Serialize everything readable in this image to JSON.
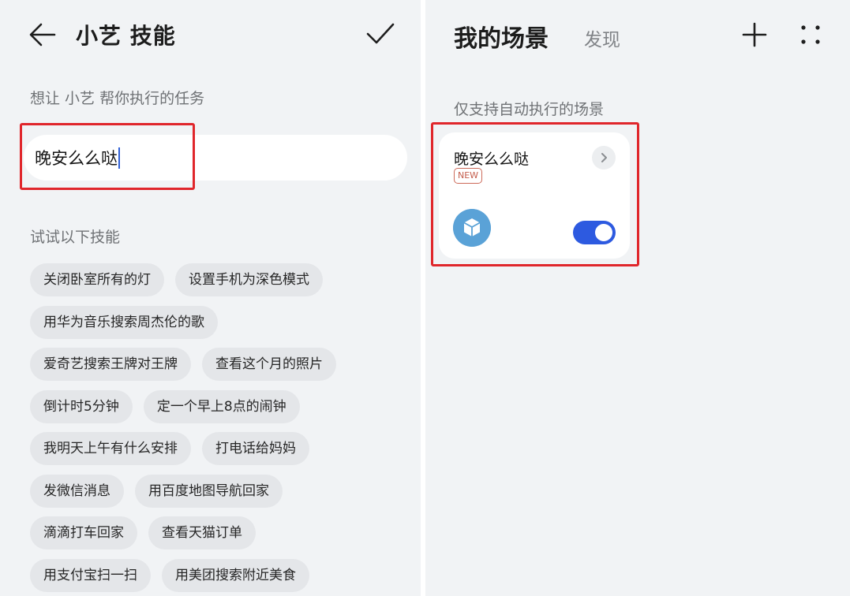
{
  "skills_panel": {
    "title": "小艺 技能",
    "task_prompt": "想让 小艺 帮你执行的任务",
    "task_value": "晚安么么哒",
    "suggestions_label": "试试以下技能",
    "suggestion_rows": [
      [
        "关闭卧室所有的灯",
        "设置手机为深色模式"
      ],
      [
        "用华为音乐搜索周杰伦的歌"
      ],
      [
        "爱奇艺搜索王牌对王牌",
        "查看这个月的照片"
      ],
      [
        "倒计时5分钟",
        "定一个早上8点的闹钟"
      ],
      [
        "我明天上午有什么安排",
        "打电话给妈妈"
      ],
      [
        "发微信消息",
        "用百度地图导航回家"
      ],
      [
        "滴滴打车回家",
        "查看天猫订单"
      ],
      [
        "用支付宝扫一扫",
        "用美团搜索附近美食"
      ]
    ],
    "icons": {
      "back": "arrow-left-icon",
      "confirm": "check-icon"
    }
  },
  "scenes_panel": {
    "title": "我的场景",
    "discover_tab": "发现",
    "auto_label": "仅支持自动执行的场景",
    "scene": {
      "name": "晚安么么哒",
      "badge": "NEW",
      "enabled": true,
      "icon": "cube-icon"
    },
    "icons": {
      "add": "plus-icon",
      "more": "more-dots-icon",
      "open": "chevron-right-icon"
    }
  },
  "colors": {
    "background": "#f1f3f5",
    "card": "#ffffff",
    "chip": "#e4e6e9",
    "highlight": "#e0262b",
    "toggle_on": "#2d5ae0",
    "badge": "#c45d4c",
    "scene_icon": "#5aa2d7"
  }
}
